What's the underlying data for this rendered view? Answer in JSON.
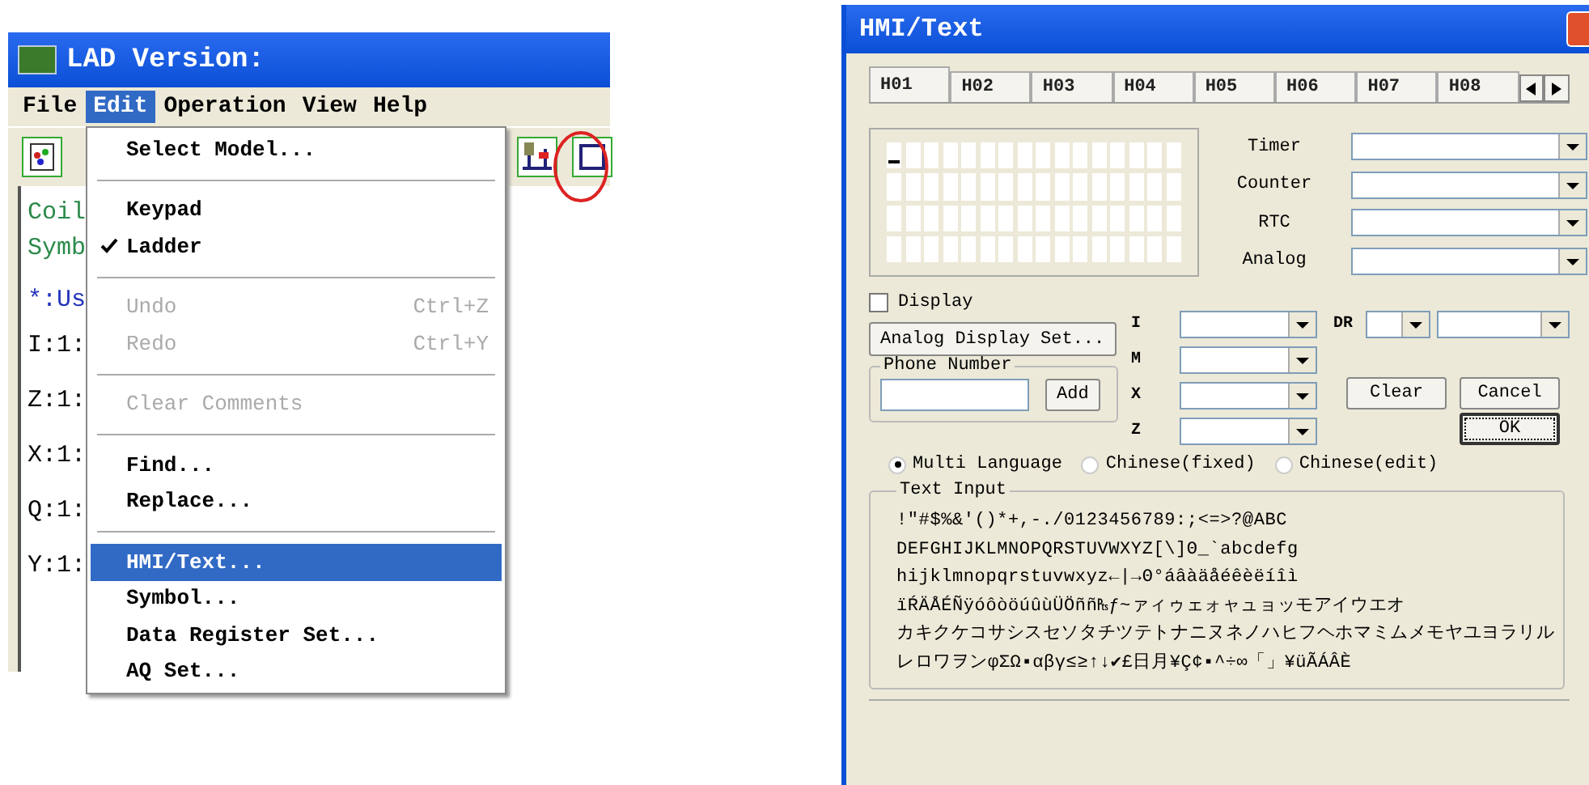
{
  "ladder_window": {
    "title": "LAD Version:",
    "menu_bar": [
      {
        "label": "File",
        "selected": false
      },
      {
        "label": "Edit",
        "selected": true
      },
      {
        "label": "Operation",
        "selected": false
      },
      {
        "label": "View",
        "selected": false
      },
      {
        "label": "Help",
        "selected": false
      }
    ],
    "content_lines": [
      {
        "text": "Coil",
        "kind": "comment"
      },
      {
        "text": "Symb",
        "kind": "comment"
      },
      {
        "text": "*:Us",
        "kind": "user"
      },
      {
        "text": "I:1:",
        "kind": "address"
      },
      {
        "text": "Z:1:",
        "kind": "address"
      },
      {
        "text": "X:1:",
        "kind": "address"
      },
      {
        "text": "Q:1:",
        "kind": "address"
      },
      {
        "text": "Y:1:",
        "kind": "address"
      }
    ],
    "edit_menu": [
      {
        "kind": "item",
        "label": "Select Model...",
        "checked": false,
        "disabled": false,
        "selected": false
      },
      {
        "kind": "separator"
      },
      {
        "kind": "item",
        "label": "Keypad",
        "checked": false,
        "disabled": false,
        "selected": false
      },
      {
        "kind": "item",
        "label": "Ladder",
        "checked": true,
        "disabled": false,
        "selected": false
      },
      {
        "kind": "separator"
      },
      {
        "kind": "item",
        "label": "Undo",
        "shortcut": "Ctrl+Z",
        "checked": false,
        "disabled": true,
        "selected": false
      },
      {
        "kind": "item",
        "label": "Redo",
        "shortcut": "Ctrl+Y",
        "checked": false,
        "disabled": true,
        "selected": false
      },
      {
        "kind": "separator"
      },
      {
        "kind": "item",
        "label": "Clear Comments",
        "checked": false,
        "disabled": true,
        "selected": false
      },
      {
        "kind": "separator"
      },
      {
        "kind": "item",
        "label": "Find...",
        "checked": false,
        "disabled": false,
        "selected": false
      },
      {
        "kind": "item",
        "label": "Replace...",
        "checked": false,
        "disabled": false,
        "selected": false
      },
      {
        "kind": "separator"
      },
      {
        "kind": "item",
        "label": "HMI/Text...",
        "checked": false,
        "disabled": false,
        "selected": true
      },
      {
        "kind": "item",
        "label": "Symbol...",
        "checked": false,
        "disabled": false,
        "selected": false
      },
      {
        "kind": "item",
        "label": "Data Register Set...",
        "checked": false,
        "disabled": false,
        "selected": false
      },
      {
        "kind": "item",
        "label": "AQ Set...",
        "checked": false,
        "disabled": false,
        "selected": false
      }
    ]
  },
  "hmi_dialog": {
    "title": "HMI/Text",
    "tabs": [
      {
        "label": "H01",
        "selected": true
      },
      {
        "label": "H02",
        "selected": false
      },
      {
        "label": "H03",
        "selected": false
      },
      {
        "label": "H04",
        "selected": false
      },
      {
        "label": "H05",
        "selected": false
      },
      {
        "label": "H06",
        "selected": false
      },
      {
        "label": "H07",
        "selected": false
      },
      {
        "label": "H08",
        "selected": false
      }
    ],
    "source_fields": [
      {
        "label": "Timer"
      },
      {
        "label": "Counter"
      },
      {
        "label": "RTC"
      },
      {
        "label": "Analog"
      }
    ],
    "display": {
      "label": "Display",
      "checked": false
    },
    "analog_button": "Analog Display Set...",
    "phone_number": {
      "label": "Phone Number",
      "add_button": "Add"
    },
    "io_fields": [
      {
        "label": "I"
      },
      {
        "label": "M"
      },
      {
        "label": "X"
      },
      {
        "label": "Z"
      }
    ],
    "dr_label": "DR",
    "buttons": {
      "clear": "Clear",
      "cancel": "Cancel",
      "ok": "OK"
    },
    "languages": [
      {
        "label": "Multi Language",
        "selected": true
      },
      {
        "label": "Chinese(fixed)",
        "selected": false
      },
      {
        "label": "Chinese(edit)",
        "selected": false
      }
    ],
    "text_input": {
      "label": "Text Input",
      "rows": [
        " !\"#$%&'()*+,-./0123456789:;<=>?@ABC",
        "DEFGHIJKLMNOPQRSTUVWXYZ[\\]Θ_`abcdefg",
        "hijklmnopqrstuvwxyz←|→Θ°áâàäåéêèëíîì",
        "ïŔÄÅÉÑÿóôòöúûùÜÖññ₧ƒ~ァィゥェォャュョッモアイウエオ",
        "カキクケコサシスセソタチツテトナニヌネノハヒフヘホマミムメモヤユヨラリル",
        "レロワヲンφΣΩ▪αβγ≤≥↑↓✔£日月¥Ç¢▪^÷∞「」¥üÃÁÂÈ"
      ]
    }
  }
}
